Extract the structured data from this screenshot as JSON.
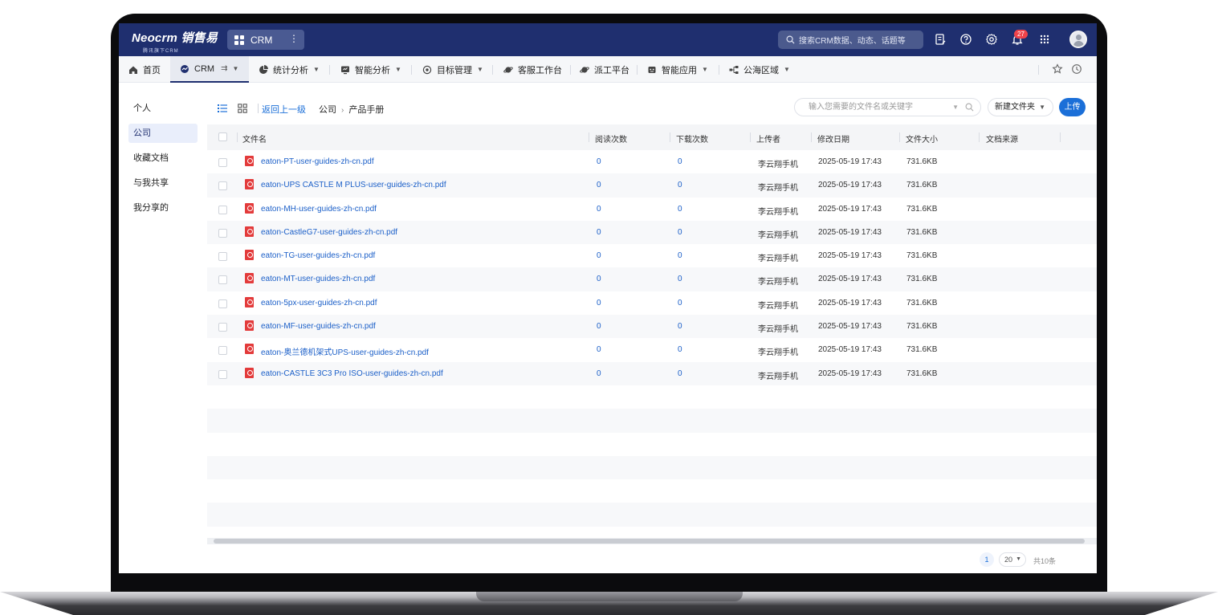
{
  "brand": {
    "name": "Neocrm 销售易",
    "tagline": "腾讯旗下CRM"
  },
  "app_switch": {
    "label": "CRM"
  },
  "header": {
    "search_placeholder": "搜索CRM数据、动态、话题等",
    "notification_count": "27"
  },
  "nav": {
    "tabs": [
      {
        "label": "首页",
        "icon": "home-icon"
      },
      {
        "label": "CRM",
        "icon": "crm-icon",
        "active": true
      },
      {
        "label": "统计分析",
        "icon": "pie-chart-icon"
      },
      {
        "label": "智能分析",
        "icon": "monitor-icon"
      },
      {
        "label": "目标管理",
        "icon": "target-icon"
      },
      {
        "label": "客服工作台",
        "icon": "planet-icon"
      },
      {
        "label": "派工平台",
        "icon": "planet-icon"
      },
      {
        "label": "智能应用",
        "icon": "robot-icon"
      },
      {
        "label": "公海区域",
        "icon": "tree-icon"
      }
    ]
  },
  "sidebar": {
    "items": [
      {
        "label": "个人"
      },
      {
        "label": "公司",
        "active": true
      },
      {
        "label": "收藏文档"
      },
      {
        "label": "与我共享"
      },
      {
        "label": "我分享的"
      }
    ]
  },
  "toolbar": {
    "back_label": "返回上一级",
    "breadcrumb": [
      "公司",
      "产品手册"
    ],
    "breadcrumb_sep": "›",
    "search_placeholder": "输入您需要的文件名或关键字",
    "new_folder_label": "新建文件夹",
    "upload_label": "上传"
  },
  "table": {
    "columns": [
      "文件名",
      "阅读次数",
      "下载次数",
      "上传者",
      "修改日期",
      "文件大小",
      "文档来源"
    ],
    "rows": [
      {
        "name": "eaton-PT-user-guides-zh-cn.pdf",
        "reads": "0",
        "downloads": "0",
        "uploader": "李云翔手机",
        "modified": "2025-05-19 17:43",
        "size": "731.6KB",
        "source": ""
      },
      {
        "name": "eaton-UPS CASTLE M PLUS-user-guides-zh-cn.pdf",
        "reads": "0",
        "downloads": "0",
        "uploader": "李云翔手机",
        "modified": "2025-05-19 17:43",
        "size": "731.6KB",
        "source": ""
      },
      {
        "name": "eaton-MH-user-guides-zh-cn.pdf",
        "reads": "0",
        "downloads": "0",
        "uploader": "李云翔手机",
        "modified": "2025-05-19 17:43",
        "size": "731.6KB",
        "source": ""
      },
      {
        "name": "eaton-CastleG7-user-guides-zh-cn.pdf",
        "reads": "0",
        "downloads": "0",
        "uploader": "李云翔手机",
        "modified": "2025-05-19 17:43",
        "size": "731.6KB",
        "source": ""
      },
      {
        "name": "eaton-TG-user-guides-zh-cn.pdf",
        "reads": "0",
        "downloads": "0",
        "uploader": "李云翔手机",
        "modified": "2025-05-19 17:43",
        "size": "731.6KB",
        "source": ""
      },
      {
        "name": "eaton-MT-user-guides-zh-cn.pdf",
        "reads": "0",
        "downloads": "0",
        "uploader": "李云翔手机",
        "modified": "2025-05-19 17:43",
        "size": "731.6KB",
        "source": ""
      },
      {
        "name": "eaton-5px-user-guides-zh-cn.pdf",
        "reads": "0",
        "downloads": "0",
        "uploader": "李云翔手机",
        "modified": "2025-05-19 17:43",
        "size": "731.6KB",
        "source": ""
      },
      {
        "name": "eaton-MF-user-guides-zh-cn.pdf",
        "reads": "0",
        "downloads": "0",
        "uploader": "李云翔手机",
        "modified": "2025-05-19 17:43",
        "size": "731.6KB",
        "source": ""
      },
      {
        "name": "eaton-奥兰德机架式UPS-user-guides-zh-cn.pdf",
        "reads": "0",
        "downloads": "0",
        "uploader": "李云翔手机",
        "modified": "2025-05-19 17:43",
        "size": "731.6KB",
        "source": ""
      },
      {
        "name": "eaton-CASTLE 3C3 Pro ISO-user-guides-zh-cn.pdf",
        "reads": "0",
        "downloads": "0",
        "uploader": "李云翔手机",
        "modified": "2025-05-19 17:43",
        "size": "731.6KB",
        "source": ""
      }
    ]
  },
  "pagination": {
    "current_page": "1",
    "page_size": "20",
    "total": "共10条"
  },
  "colors": {
    "header_bg": "#1f2f6f",
    "link": "#1b5fc8",
    "primary": "#1b6fd8",
    "pdf_icon": "#e33b3b",
    "badge": "#f0434a"
  }
}
